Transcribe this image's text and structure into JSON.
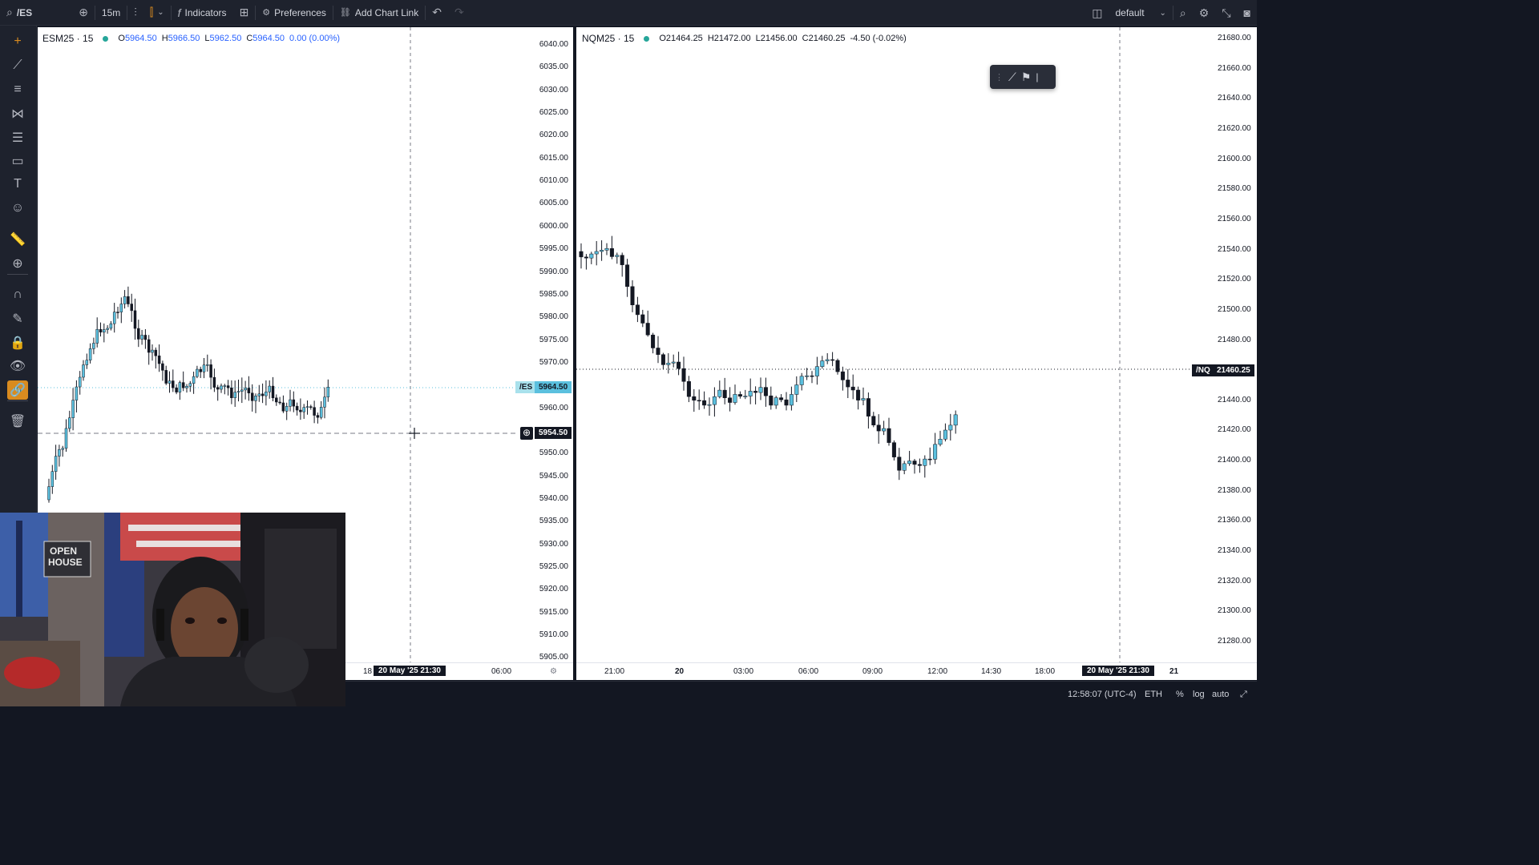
{
  "topbar": {
    "symbol": "/ES",
    "interval": "15m",
    "indicators_label": "Indicators",
    "preferences_label": "Preferences",
    "add_chart_link_label": "Add Chart Link",
    "layout_name": "default"
  },
  "left_tools": [
    {
      "name": "crosshair-icon",
      "glyph": "+"
    },
    {
      "name": "trend-line-icon",
      "glyph": "⟋"
    },
    {
      "name": "horizontal-lines-icon",
      "glyph": "≡"
    },
    {
      "name": "pattern-icon",
      "glyph": "⋈"
    },
    {
      "name": "fib-icon",
      "glyph": "☰"
    },
    {
      "name": "rectangle-icon",
      "glyph": "▭"
    },
    {
      "name": "text-icon",
      "glyph": "T"
    },
    {
      "name": "emoji-icon",
      "glyph": "☺"
    },
    {
      "name": "ruler-icon",
      "glyph": "📏"
    },
    {
      "name": "zoom-in-icon",
      "glyph": "⊕"
    },
    {
      "name": "magnet-icon",
      "glyph": "∩"
    },
    {
      "name": "stay-drawing-icon",
      "glyph": "✎"
    },
    {
      "name": "lock-icon",
      "glyph": "🔒"
    },
    {
      "name": "eye-icon",
      "glyph": "👁"
    },
    {
      "name": "link-icon",
      "glyph": "🔗"
    },
    {
      "name": "trash-icon",
      "glyph": "🗑"
    }
  ],
  "es_chart": {
    "symbol": "ESM25 · 15",
    "open": "5964.50",
    "high": "5966.50",
    "low": "5962.50",
    "close": "5964.50",
    "change": "0.00 (0.00%)",
    "price_axis": [
      "6040.00",
      "6035.00",
      "6030.00",
      "6025.00",
      "6020.00",
      "6015.00",
      "6010.00",
      "6005.00",
      "6000.00",
      "5995.00",
      "5990.00",
      "5985.00",
      "5980.00",
      "5975.00",
      "5970.00",
      "5960.00",
      "5955.00",
      "5950.00",
      "5945.00",
      "5940.00",
      "5935.00",
      "5930.00",
      "5925.00",
      "5920.00",
      "5915.00",
      "5910.00",
      "5905.00"
    ],
    "last_price_tag": "5964.50",
    "last_price_label": "/ES",
    "crosshair_price": "5954.50",
    "time_labels": {
      "left": "18",
      "crosshair": "20 May '25   21:30",
      "right": "06:00"
    }
  },
  "nq_chart": {
    "symbol": "NQM25 · 15",
    "open": "21464.25",
    "high": "21472.00",
    "low": "21456.00",
    "close": "21460.25",
    "change": "-4.50 (-0.02%)",
    "price_axis": [
      "21680.00",
      "21660.00",
      "21640.00",
      "21620.00",
      "21600.00",
      "21580.00",
      "21560.00",
      "21540.00",
      "21520.00",
      "21500.00",
      "21480.00",
      "21440.00",
      "21420.00",
      "21400.00",
      "21380.00",
      "21360.00",
      "21340.00",
      "21320.00",
      "21300.00",
      "21280.00"
    ],
    "last_price_tag": "21460.25",
    "last_price_label": "/NQ",
    "time_labels": [
      "21:00",
      "20",
      "03:00",
      "06:00",
      "09:00",
      "12:00",
      "14:30",
      "18:00"
    ],
    "crosshair_time": "20 May '25   21:30",
    "next_day": "21"
  },
  "status_bar": {
    "clock": "12:58:07 (UTC-4)",
    "session": "ETH",
    "percent": "%",
    "log": "log",
    "auto": "auto"
  },
  "webcam": {
    "sign_line1": "OPEN",
    "sign_line2": "HOUSE"
  },
  "colors": {
    "up": "#5bc0de",
    "down": "#131722",
    "accent": "#d98b1f"
  }
}
